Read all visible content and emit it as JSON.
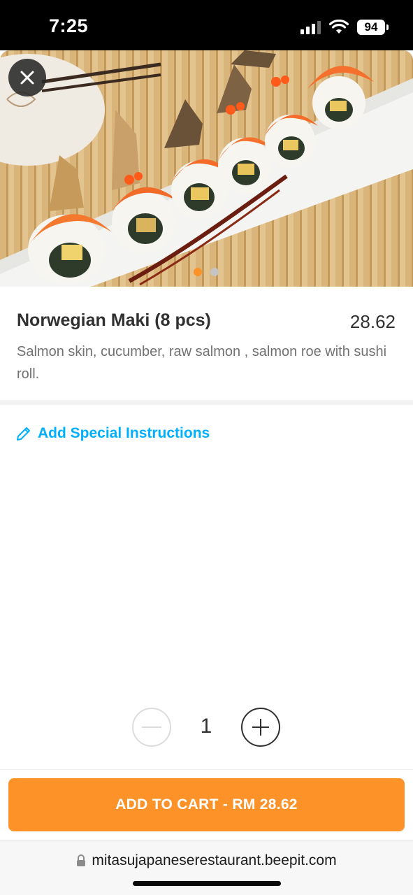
{
  "status_bar": {
    "time": "7:25",
    "battery": "94",
    "icons": [
      "signal-icon",
      "wifi-icon",
      "battery-icon"
    ]
  },
  "hero": {
    "image_subject": "sushi-maki-rolls",
    "carousel": {
      "count": 2,
      "active_index": 0
    },
    "close_icon": "close-icon"
  },
  "product": {
    "name": "Norwegian Maki (8 pcs)",
    "price": "28.62",
    "description": "Salmon skin, cucumber, raw salmon , salmon roe with sushi roll."
  },
  "instructions": {
    "icon": "pencil-icon",
    "label": "Add Special Instructions"
  },
  "quantity": {
    "value": "1",
    "minus_icon": "minus-icon",
    "plus_icon": "plus-icon"
  },
  "cart_button": {
    "label": "ADD TO CART - RM 28.62"
  },
  "browser": {
    "lock_icon": "lock-icon",
    "url": "mitasujapaneserestaurant.beepit.com"
  },
  "colors": {
    "accent": "#fc9228",
    "link": "#00b0ff",
    "text": "#303030",
    "muted": "#717171"
  }
}
